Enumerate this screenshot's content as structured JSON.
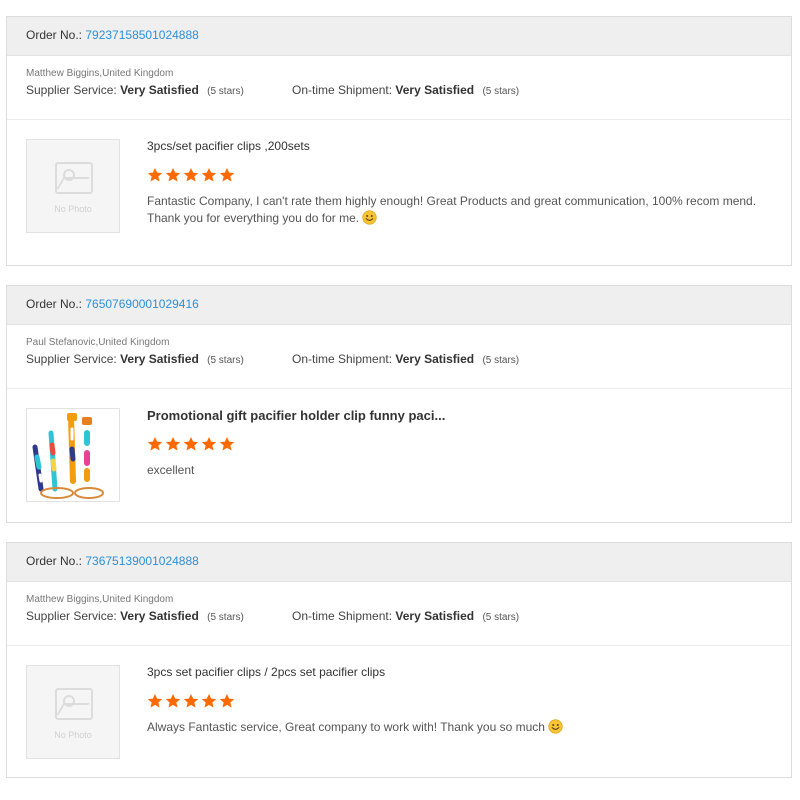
{
  "labels": {
    "order_no": "Order No.:",
    "supplier_service": "Supplier Service:",
    "ontime_shipment": "On-time Shipment:",
    "no_photo": "No Photo"
  },
  "colors": {
    "star": "#ff6a00",
    "link": "#2e8fd6",
    "header_bg": "#efefef"
  },
  "reviews": [
    {
      "order_no": "79237158501024888",
      "buyer": "Matthew Biggins,United Kingdom",
      "supplier_service_value": "Very Satisfied",
      "supplier_service_stars": "(5 stars)",
      "ontime_value": "Very Satisfied",
      "ontime_stars": "(5 stars)",
      "product_title": "3pcs/set pacifier clips ,200sets",
      "rating": 5,
      "review_text": "Fantastic Company, I can't rate them highly enough! Great Products and great communication, 100% recom mend. Thank you for everything you do for me.",
      "has_photo": false,
      "emoji": "smiley-icon"
    },
    {
      "order_no": "76507690001029416",
      "buyer": "Paul Stefanovic,United Kingdom",
      "supplier_service_value": "Very Satisfied",
      "supplier_service_stars": "(5 stars)",
      "ontime_value": "Very Satisfied",
      "ontime_stars": "(5 stars)",
      "product_title": "Promotional gift pacifier holder clip funny paci...",
      "rating": 5,
      "review_text": "excellent",
      "has_photo": true,
      "emoji": ""
    },
    {
      "order_no": "73675139001024888",
      "buyer": "Matthew Biggins,United Kingdom",
      "supplier_service_value": "Very Satisfied",
      "supplier_service_stars": "(5 stars)",
      "ontime_value": "Very Satisfied",
      "ontime_stars": "(5 stars)",
      "product_title": "3pcs set pacifier clips / 2pcs set pacifier clips",
      "rating": 5,
      "review_text": "Always Fantastic service, Great company to work with! Thank you so much",
      "has_photo": false,
      "emoji": "smiley-icon"
    }
  ]
}
